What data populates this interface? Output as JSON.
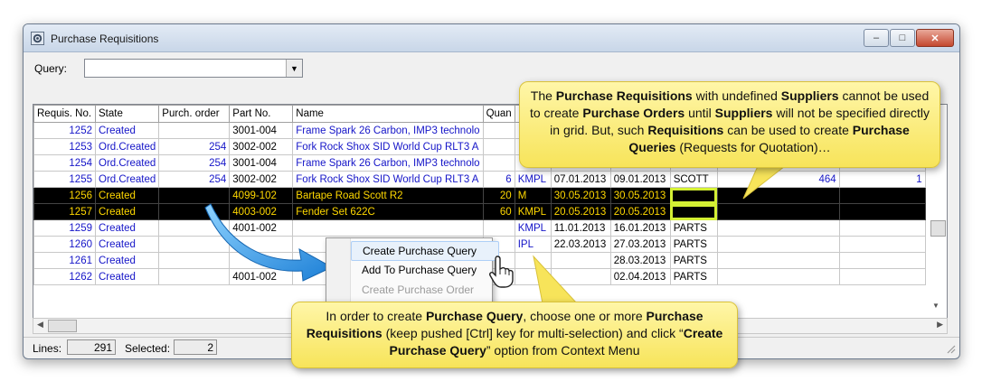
{
  "window": {
    "title": "Purchase Requisitions",
    "controls": {
      "minimize": "–",
      "maximize": "□",
      "close": "✕"
    }
  },
  "query": {
    "label": "Query:",
    "value": ""
  },
  "grid": {
    "columns": [
      "Requis. No.",
      "State",
      "Purch. order",
      "Part No.",
      "Name",
      "Quan",
      "",
      "",
      "",
      "",
      "",
      ""
    ],
    "rows": [
      {
        "no": "1252",
        "state": "Created",
        "po": "",
        "part": "3001-004",
        "name": "Frame Spark 26 Carbon, IMP3 technolo",
        "qty": "",
        "unit": "",
        "d1": "",
        "d2": "",
        "sup": "",
        "c10": "",
        "c11": "",
        "sel": false
      },
      {
        "no": "1253",
        "state": "Ord.Created",
        "po": "254",
        "part": "3002-002",
        "name": "Fork Rock Shox SID World Cup RLT3 A",
        "qty": "",
        "unit": "",
        "d1": "",
        "d2": "",
        "sup": "",
        "c10": "",
        "c11": "",
        "sel": false
      },
      {
        "no": "1254",
        "state": "Ord.Created",
        "po": "254",
        "part": "3001-004",
        "name": "Frame Spark 26 Carbon, IMP3 technolo",
        "qty": "",
        "unit": "",
        "d1": "",
        "d2": "",
        "sup": "",
        "c10": "",
        "c11": "",
        "sel": false
      },
      {
        "no": "1255",
        "state": "Ord.Created",
        "po": "254",
        "part": "3002-002",
        "name": "Fork Rock Shox SID World Cup RLT3 A",
        "qty": "6",
        "unit": "KMPL",
        "d1": "07.01.2013",
        "d2": "09.01.2013",
        "sup": "SCOTT",
        "c10": "464",
        "c11": "1",
        "sel": false
      },
      {
        "no": "1256",
        "state": "Created",
        "po": "",
        "part": "4099-102",
        "name": "Bartape Road Scott R2",
        "qty": "20",
        "unit": "M",
        "d1": "30.05.2013",
        "d2": "30.05.2013",
        "sup": "",
        "c10": "",
        "c11": "",
        "sel": true
      },
      {
        "no": "1257",
        "state": "Created",
        "po": "",
        "part": "4003-002",
        "name": "Fender Set 622C",
        "qty": "60",
        "unit": "KMPL",
        "d1": "20.05.2013",
        "d2": "20.05.2013",
        "sup": "",
        "c10": "",
        "c11": "",
        "sel": true
      },
      {
        "no": "1259",
        "state": "Created",
        "po": "",
        "part": "4001-002",
        "name": "",
        "qty": "",
        "unit": "KMPL",
        "d1": "11.01.2013",
        "d2": "16.01.2013",
        "sup": "PARTS",
        "c10": "",
        "c11": "",
        "sel": false
      },
      {
        "no": "1260",
        "state": "Created",
        "po": "",
        "part": "",
        "name": "",
        "qty": "",
        "unit": "IPL",
        "d1": "22.03.2013",
        "d2": "27.03.2013",
        "sup": "PARTS",
        "c10": "",
        "c11": "",
        "sel": false
      },
      {
        "no": "1261",
        "state": "Created",
        "po": "",
        "part": "",
        "name": "",
        "qty": "",
        "unit": "",
        "d1": "",
        "d2": "28.03.2013",
        "sup": "PARTS",
        "c10": "",
        "c11": "",
        "sel": false
      },
      {
        "no": "1262",
        "state": "Created",
        "po": "",
        "part": "4001-002",
        "name": "",
        "qty": "",
        "unit": "",
        "d1": "",
        "d2": "02.04.2013",
        "sup": "PARTS",
        "c10": "",
        "c11": "",
        "sel": false
      }
    ]
  },
  "context_menu": {
    "items": [
      {
        "label": "Create Purchase Query",
        "state": "active"
      },
      {
        "label": "Add To Purchase Query",
        "state": "normal"
      },
      {
        "label": "Create Purchase Order",
        "state": "disabled"
      }
    ]
  },
  "status": {
    "lines_label": "Lines:",
    "lines": "291",
    "selected_label": "Selected:",
    "selected": "2"
  },
  "callouts": {
    "top": [
      {
        "t": "The "
      },
      {
        "b": "Purchase Requisitions"
      },
      {
        "t": " with undefined "
      },
      {
        "b": "Suppliers"
      },
      {
        "t": " cannot be used to create "
      },
      {
        "b": "Purchase Orders"
      },
      {
        "t": " until "
      },
      {
        "b": "Suppliers"
      },
      {
        "t": " will not be specified directly in grid.  But, such "
      },
      {
        "b": "Requisitions"
      },
      {
        "t": " can be used to create "
      },
      {
        "b": "Purchase Queries"
      },
      {
        "t": " (Requests for Quotation)…"
      }
    ],
    "bottom": [
      {
        "t": "In order to create "
      },
      {
        "b": "Purchase Query"
      },
      {
        "t": ", choose one or more "
      },
      {
        "b": "Purchase Requisitions"
      },
      {
        "t": " (keep pushed [Ctrl] key for multi-selection) and click “"
      },
      {
        "b": "Create Purchase Query"
      },
      {
        "t": "” option from Context Menu"
      }
    ]
  },
  "colors": {
    "link_text": "#1515c8",
    "selected_bg": "#000000",
    "selected_text": "#ffd800",
    "callout_bg": "#fbee7a",
    "highlight": "#d4f034"
  }
}
